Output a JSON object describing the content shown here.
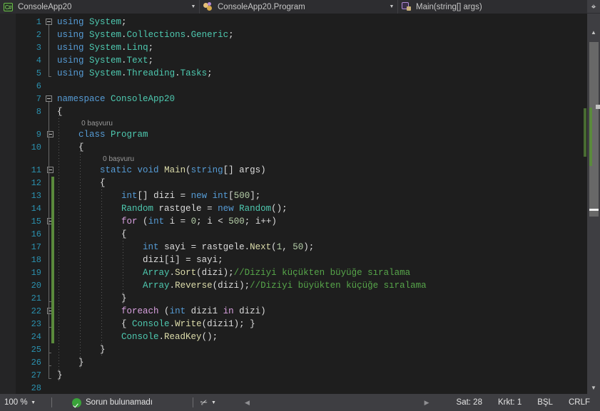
{
  "navbar": {
    "project": {
      "label": "ConsoleApp20",
      "icon": "csharp-file-icon",
      "arrow": "▼"
    },
    "class": {
      "label": "ConsoleApp20.Program",
      "icon": "class-icon",
      "arrow": "▼"
    },
    "member": {
      "label": "Main(string[] args)",
      "icon": "method-private-icon",
      "arrow": "▼"
    }
  },
  "editor": {
    "line_numbers": [
      "1",
      "2",
      "3",
      "4",
      "5",
      "6",
      "7",
      "8",
      "9",
      "10",
      "11",
      "12",
      "13",
      "14",
      "15",
      "16",
      "17",
      "18",
      "19",
      "20",
      "21",
      "22",
      "23",
      "24",
      "25",
      "26",
      "27",
      "28"
    ],
    "codelens": [
      {
        "text": "0 başvuru",
        "for_line": 9
      },
      {
        "text": "0 başvuru",
        "for_line": 11
      }
    ],
    "code_lines": [
      {
        "n": 1,
        "text": "using System;"
      },
      {
        "n": 2,
        "text": "using System.Collections.Generic;"
      },
      {
        "n": 3,
        "text": "using System.Linq;"
      },
      {
        "n": 4,
        "text": "using System.Text;"
      },
      {
        "n": 5,
        "text": "using System.Threading.Tasks;"
      },
      {
        "n": 6,
        "text": ""
      },
      {
        "n": 7,
        "text": "namespace ConsoleApp20"
      },
      {
        "n": 8,
        "text": "{"
      },
      {
        "n": 9,
        "text": "    class Program"
      },
      {
        "n": 10,
        "text": "    {"
      },
      {
        "n": 11,
        "text": "        static void Main(string[] args)"
      },
      {
        "n": 12,
        "text": "        {"
      },
      {
        "n": 13,
        "text": "            int[] dizi = new int[500];"
      },
      {
        "n": 14,
        "text": "            Random rastgele = new Random();"
      },
      {
        "n": 15,
        "text": "            for (int i = 0; i < 500; i++)"
      },
      {
        "n": 16,
        "text": "            {"
      },
      {
        "n": 17,
        "text": "                int sayi = rastgele.Next(1, 50);"
      },
      {
        "n": 18,
        "text": "                dizi[i] = sayi;"
      },
      {
        "n": 19,
        "text": "                Array.Sort(dizi);//Diziyi küçükten büyüğe sıralama"
      },
      {
        "n": 20,
        "text": "                Array.Reverse(dizi);//Diziyi büyükten küçüğe sıralama"
      },
      {
        "n": 21,
        "text": "            }"
      },
      {
        "n": 22,
        "text": "            foreach (int dizi1 in dizi)"
      },
      {
        "n": 23,
        "text": "            { Console.Write(dizi1); }"
      },
      {
        "n": 24,
        "text": "            Console.ReadKey();"
      },
      {
        "n": 25,
        "text": "        }"
      },
      {
        "n": 26,
        "text": "    }"
      },
      {
        "n": 27,
        "text": "}"
      },
      {
        "n": 28,
        "text": ""
      }
    ],
    "cursor_line": 28,
    "colors": {
      "background": "#1e1e1e",
      "line_number": "#2b91af",
      "keyword": "#569cd6",
      "control_keyword": "#d8a0df",
      "type": "#4ec9b0",
      "string_number": "#b5cea8",
      "comment": "#57a64a",
      "method": "#dcdcaa",
      "identifier": "#dcdcdc",
      "change_bar": "#5a8a3c"
    }
  },
  "scrollbar": {
    "split_icon": "split-view-icon",
    "up_arrow": "▲",
    "down_arrow": "▼"
  },
  "statusbar": {
    "zoom": "100 %",
    "zoom_arrow": "▼",
    "issues": "Sorun bulunamadı",
    "issues_icon": "success-check-icon",
    "publish_icon": "publish-icon",
    "publish_arrow": "▼",
    "nav_back": "◀",
    "nav_forward": "▶",
    "line": "Sat: 28",
    "column": "Krkt: 1",
    "insert_mode": "BŞL",
    "line_endings": "CRLF"
  }
}
